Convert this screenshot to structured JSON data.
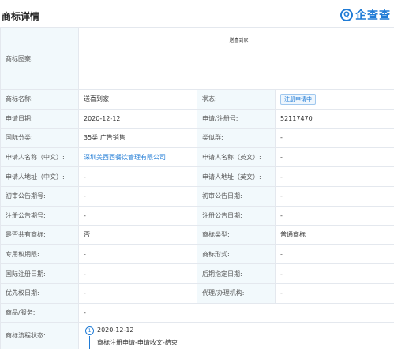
{
  "header": {
    "title": "商标详情",
    "brand_text": "企查查",
    "brand_logo": "Q"
  },
  "logo": {
    "label": "商标图案:",
    "text": "送喜到家"
  },
  "rows": [
    {
      "k1": "商标名称:",
      "v1": "送喜到家",
      "k2": "状态:",
      "v2": "注册申请中"
    },
    {
      "k1": "申请日期:",
      "v1": "2020-12-12",
      "k2": "申请/注册号:",
      "v2": "52117470"
    },
    {
      "k1": "国际分类:",
      "v1": "35类 广告销售",
      "k2": "类似群:",
      "v2": "-"
    },
    {
      "k1": "申请人名称（中文）:",
      "v1": "深圳美西西餐饮管理有限公司",
      "k2": "申请人名称（英文）:",
      "v2": "-"
    },
    {
      "k1": "申请人地址（中文）:",
      "v1": "-",
      "k2": "申请人地址（英文）:",
      "v2": "-"
    },
    {
      "k1": "初审公告期号:",
      "v1": "-",
      "k2": "初审公告日期:",
      "v2": "-"
    },
    {
      "k1": "注册公告期号:",
      "v1": "-",
      "k2": "注册公告日期:",
      "v2": "-"
    },
    {
      "k1": "是否共有商标:",
      "v1": "否",
      "k2": "商标类型:",
      "v2": "普通商标"
    },
    {
      "k1": "专用权期限:",
      "v1": "-",
      "k2": "商标形式:",
      "v2": "-"
    },
    {
      "k1": "国际注册日期:",
      "v1": "-",
      "k2": "后期指定日期:",
      "v2": "-"
    },
    {
      "k1": "优先权日期:",
      "v1": "-",
      "k2": "代理/办理机构:",
      "v2": "-"
    }
  ],
  "services": {
    "label": "商品/服务:",
    "value": "-"
  },
  "flow": {
    "label": "商标流程状态:",
    "step_number": "1",
    "date": "2020-12-12",
    "steps": "商标注册申请-申请收文-结束"
  }
}
